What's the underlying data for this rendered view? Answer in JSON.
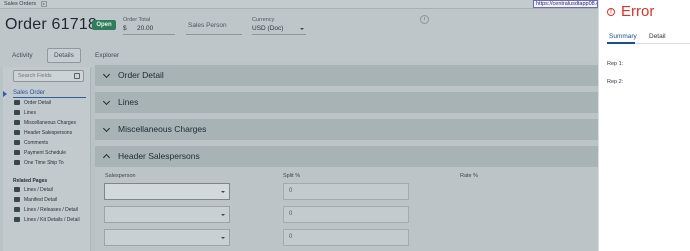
{
  "browser": {
    "tab_label": "Sales Orders",
    "tab_close": "x",
    "url_tooltip": "https://centralusdtapp08.e"
  },
  "header": {
    "title": "Order 61718",
    "status_badge": "Open",
    "order_total": {
      "label": "Order Total",
      "currency_symbol": "$",
      "value": "20.00"
    },
    "sales_person_placeholder": "Sales Person",
    "currency": {
      "label": "Currency",
      "value": "USD (Doc)"
    }
  },
  "tabs": [
    {
      "label": "Activity"
    },
    {
      "label": "Details",
      "active": true
    },
    {
      "label": "Explorer"
    }
  ],
  "sidebar": {
    "search_placeholder": "Search Fields",
    "section": "Sales Order",
    "items": [
      {
        "label": "Order Detail",
        "icon": "form-icon"
      },
      {
        "label": "Lines",
        "icon": "list-icon"
      },
      {
        "label": "Miscellaneous Charges",
        "icon": "list-icon"
      },
      {
        "label": "Header Salespersons",
        "icon": "list-icon"
      },
      {
        "label": "Comments",
        "icon": "comment-icon"
      },
      {
        "label": "Payment Schedule",
        "icon": "list-icon"
      },
      {
        "label": "One Time Ship To",
        "icon": "form-icon"
      }
    ],
    "related_title": "Related Pages",
    "related": [
      {
        "label": "Lines / Detail"
      },
      {
        "label": "Manifest Detail"
      },
      {
        "label": "Lines / Releases / Detail"
      },
      {
        "label": "Lines / Kit Details / Detail"
      }
    ]
  },
  "panels": [
    {
      "title": "Order Detail",
      "expanded": false
    },
    {
      "title": "Lines",
      "expanded": false
    },
    {
      "title": "Miscellaneous Charges",
      "expanded": false
    },
    {
      "title": "Header Salespersons",
      "expanded": true
    }
  ],
  "salespersons_grid": {
    "columns": [
      "Salesperson",
      "Split %",
      "Rate %"
    ],
    "rows": [
      {
        "salesperson": "",
        "split": "0"
      },
      {
        "salesperson": "",
        "split": "0"
      },
      {
        "salesperson": "",
        "split": "0"
      }
    ]
  },
  "error_pane": {
    "title": "Error",
    "tabs": [
      "Summary",
      "Detail"
    ],
    "fields": [
      {
        "label": "Rep 1:"
      },
      {
        "label": "Rep 2:"
      }
    ],
    "accent_color": "#d9342b"
  }
}
